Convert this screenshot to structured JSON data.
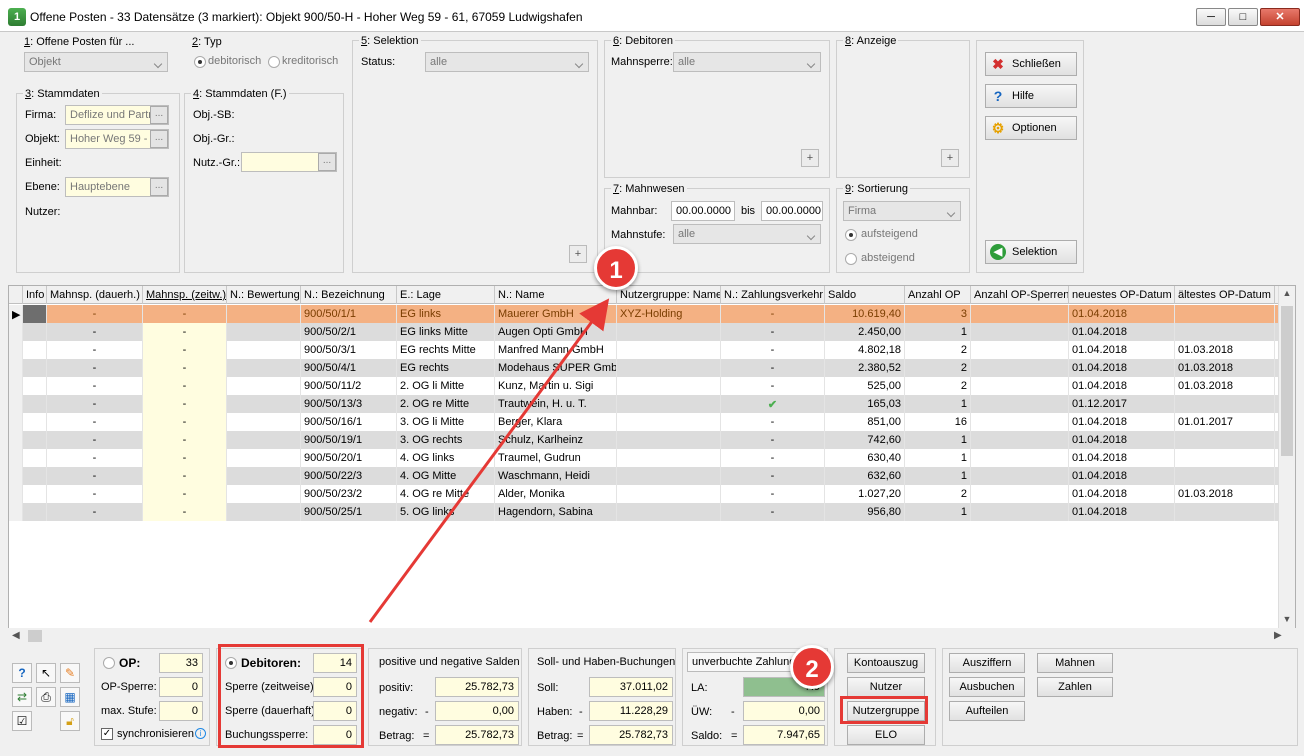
{
  "window": {
    "title": "Offene Posten - 33 Datensätze (3 markiert):  Objekt 900/50-H - Hoher Weg 59 - 61, 67059 Ludwigshafen",
    "icon": "app-icon",
    "min": "─",
    "max": "□",
    "close": "✕"
  },
  "sel1": {
    "legend_key": "1",
    "legend_rest": ": Offene Posten für ...",
    "combo": "Objekt"
  },
  "sel2": {
    "legend_key": "2",
    "legend_rest": ": Typ",
    "opt1": "debitorisch",
    "opt2": "kreditorisch"
  },
  "sel3": {
    "legend_key": "3",
    "legend_rest": ": Stammdaten",
    "firma_label": "Firma:",
    "firma_value": "Deflize und Partr",
    "objekt_label": "Objekt:",
    "objekt_value": "Hoher Weg 59 -",
    "einheit_label": "Einheit:",
    "ebene_label": "Ebene:",
    "ebene_value": "Hauptebene",
    "nutzer_label": "Nutzer:",
    "dots": "..."
  },
  "sel4": {
    "legend_key": "4",
    "legend_rest": ": Stammdaten (F.)",
    "objsb": "Obj.-SB:",
    "objgr": "Obj.-Gr.:",
    "nutzgr": "Nutz.-Gr.:"
  },
  "sel5": {
    "legend_key": "5",
    "legend_rest": ": Selektion",
    "status_label": "Status:",
    "status_value": "alle",
    "plus": "+"
  },
  "sel6": {
    "legend_key": "6",
    "legend_rest": ": Debitoren",
    "mahnsperre_label": "Mahnsperre:",
    "mahnsperre_value": "alle"
  },
  "sel7": {
    "legend_key": "7",
    "legend_rest": ": Mahnwesen",
    "mahnbar_label": "Mahnbar:",
    "from": "00.00.0000",
    "bis": "bis",
    "to": "00.00.0000",
    "mahnstufe_label": "Mahnstufe:",
    "mahnstufe_value": "alle"
  },
  "sel8": {
    "legend_key": "8",
    "legend_rest": ": Anzeige"
  },
  "sel9": {
    "legend_key": "9",
    "legend_rest": ": Sortierung",
    "combo": "Firma",
    "opt1": "aufsteigend",
    "opt2": "absteigend"
  },
  "buttons": {
    "schliessen": "Schließen",
    "hilfe": "Hilfe",
    "optionen": "Optionen",
    "selektion": "Selektion"
  },
  "grid": {
    "columns": [
      "Info",
      "Mahnsp. (dauerh.)",
      "Mahnsp. (zeitw.)",
      "N.: Bewertung",
      "N.: Bezeichnung",
      "E.: Lage",
      "N.: Name",
      "Nutzergruppe: Name",
      "N.: Zahlungsverkehr",
      "Saldo",
      "Anzahl OP",
      "Anzahl OP-Sperren",
      "neuestes OP-Datum",
      "ältestes OP-Datum"
    ],
    "rows": [
      [
        "",
        "-",
        "-",
        "",
        "900/50/1/1",
        "EG links",
        "Mauerer GmbH",
        "XYZ-Holding",
        "-",
        "10.619,40",
        "3",
        "",
        "01.04.2018",
        ""
      ],
      [
        "",
        "-",
        "-",
        "",
        "900/50/2/1",
        "EG links Mitte",
        "Augen Opti GmbH",
        "",
        "-",
        "2.450,00",
        "1",
        "",
        "01.04.2018",
        ""
      ],
      [
        "",
        "-",
        "-",
        "",
        "900/50/3/1",
        "EG rechts Mitte",
        "Manfred Mann GmbH",
        "",
        "-",
        "4.802,18",
        "2",
        "",
        "01.04.2018",
        "01.03.2018"
      ],
      [
        "",
        "-",
        "-",
        "",
        "900/50/4/1",
        "EG rechts",
        "Modehaus SUPER Gmbl",
        "",
        "-",
        "2.380,52",
        "2",
        "",
        "01.04.2018",
        "01.03.2018"
      ],
      [
        "",
        "-",
        "-",
        "",
        "900/50/11/2",
        "2. OG li Mitte",
        "Kunz, Martin u. Sigi",
        "",
        "-",
        "525,00",
        "2",
        "",
        "01.04.2018",
        "01.03.2018"
      ],
      [
        "",
        "-",
        "-",
        "",
        "900/50/13/3",
        "2. OG re Mitte",
        "Trautwein, H. u. T.",
        "",
        "✔",
        "165,03",
        "1",
        "",
        "01.12.2017",
        ""
      ],
      [
        "",
        "-",
        "-",
        "",
        "900/50/16/1",
        "3. OG li Mitte",
        "Berger, Klara",
        "",
        "-",
        "851,00",
        "16",
        "",
        "01.04.2018",
        "01.01.2017"
      ],
      [
        "",
        "-",
        "-",
        "",
        "900/50/19/1",
        "3. OG rechts",
        "Schulz, Karlheinz",
        "",
        "-",
        "742,60",
        "1",
        "",
        "01.04.2018",
        ""
      ],
      [
        "",
        "-",
        "-",
        "",
        "900/50/20/1",
        "4. OG links",
        "Traumel, Gudrun",
        "",
        "-",
        "630,40",
        "1",
        "",
        "01.04.2018",
        ""
      ],
      [
        "",
        "-",
        "-",
        "",
        "900/50/22/3",
        "4. OG Mitte",
        "Waschmann, Heidi",
        "",
        "-",
        "632,60",
        "1",
        "",
        "01.04.2018",
        ""
      ],
      [
        "",
        "-",
        "-",
        "",
        "900/50/23/2",
        "4. OG re Mitte",
        "Alder, Monika",
        "",
        "-",
        "1.027,20",
        "2",
        "",
        "01.04.2018",
        "01.03.2018"
      ],
      [
        "",
        "-",
        "-",
        "",
        "900/50/25/1",
        "5. OG links",
        "Hagendorn, Sabina",
        "",
        "-",
        "956,80",
        "1",
        "",
        "01.04.2018",
        ""
      ]
    ]
  },
  "bottom": {
    "op_label": "OP:",
    "op_value": "33",
    "opsperre_label": "OP-Sperre:",
    "opsperre_value": "0",
    "maxstufe_label": "max. Stufe:",
    "maxstufe_value": "0",
    "sync_label": "synchronisieren",
    "deb_label": "Debitoren:",
    "deb_value": "14",
    "sperre_z_label": "Sperre (zeitweise):",
    "sperre_z_value": "0",
    "sperre_d_label": "Sperre (dauerhaft):",
    "sperre_d_value": "0",
    "buch_label": "Buchungssperre:",
    "buch_value": "0",
    "salden_title": "positive und negative Salden",
    "positiv_label": "positiv:",
    "positiv_value": "25.782,73",
    "negativ_label": "negativ:",
    "negativ_sign": "-",
    "negativ_value": "0,00",
    "betrag_label": "Betrag:",
    "betrag_sign": "=",
    "betrag_value": "25.782,73",
    "buch_title": "Soll- und Haben-Buchungen",
    "soll_label": "Soll:",
    "soll_value": "37.011,02",
    "haben_label": "Haben:",
    "haben_sign": "-",
    "haben_value": "11.228,29",
    "betrag2_label": "Betrag:",
    "betrag2_sign": "=",
    "betrag2_value": "25.782,73",
    "unv_title": "unverbuchte Zahlung",
    "la_label": "LA:",
    "la_value": "7.9",
    "uew_label": "ÜW:",
    "uew_sign": "-",
    "uew_value": "0,00",
    "saldo_label": "Saldo:",
    "saldo_sign": "=",
    "saldo_value": "7.947,65",
    "kontoauszug": "Kontoauszug",
    "nutzer": "Nutzer",
    "nutzergruppe": "Nutzergruppe",
    "elo": "ELO",
    "ausziffern": "Ausziffern",
    "mahnen": "Mahnen",
    "ausbuchen": "Ausbuchen",
    "zahlen": "Zahlen",
    "aufteilen": "Aufteilen"
  },
  "annotations": {
    "badge1": "1",
    "badge2": "2"
  },
  "colors": {
    "selected_row": "#f4b183",
    "highlight": "#e53935",
    "yellow_field": "#fffde0"
  }
}
